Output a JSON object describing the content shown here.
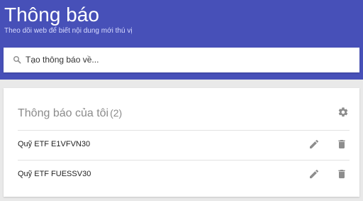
{
  "header": {
    "title": "Thông báo",
    "subtitle": "Theo dõi web để biết nội dung mới thú vị"
  },
  "search": {
    "placeholder": "Tạo thông báo về..."
  },
  "notifications_card": {
    "title": "Thông báo của tôi",
    "count": "(2)",
    "items": [
      {
        "label": "Quỹ ETF E1VFVN30"
      },
      {
        "label": "Quỹ ETF FUESSV30"
      }
    ]
  },
  "colors": {
    "header_background": "#4750b8",
    "page_background": "#e9e9e9",
    "card_background": "#ffffff",
    "icon": "#8d8d8d"
  },
  "icons": {
    "search": "search-icon",
    "settings": "gear-icon",
    "edit": "pencil-icon",
    "delete": "trash-icon"
  }
}
